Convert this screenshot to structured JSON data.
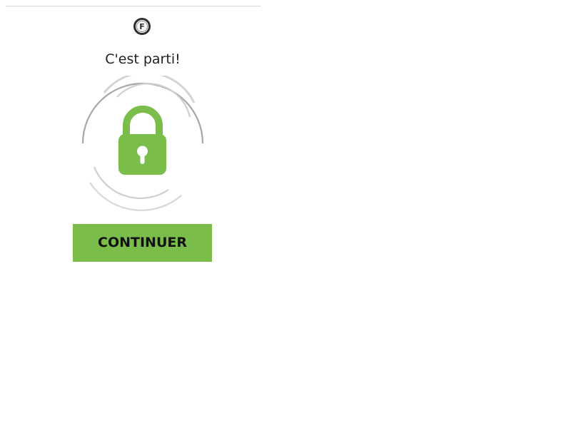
{
  "header": {
    "logo_icon": "f-logo-icon",
    "logo_letter": "F"
  },
  "main": {
    "title": "C'est parti!",
    "lock_icon": "padlock-icon",
    "accent_color": "#7abd4a",
    "continue_label": "CONTINUER"
  }
}
